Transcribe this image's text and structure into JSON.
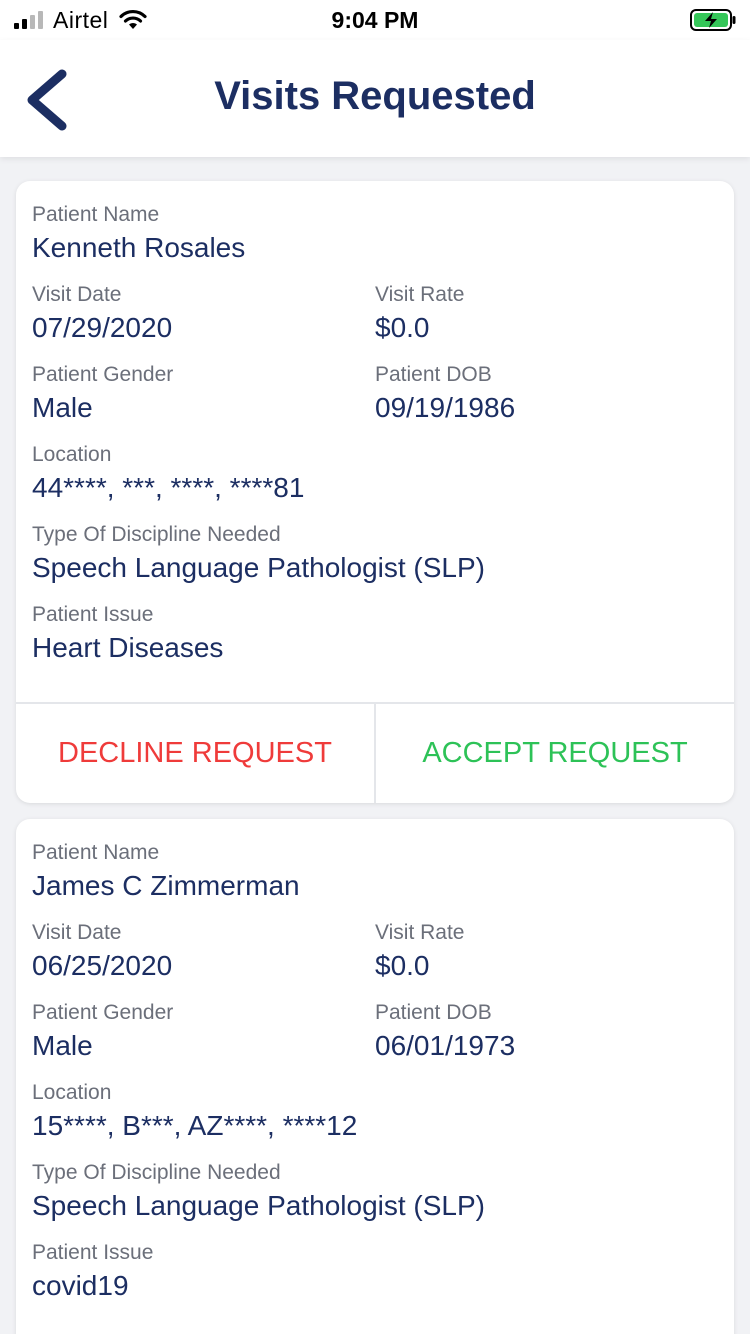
{
  "status_bar": {
    "carrier": "Airtel",
    "time": "9:04 PM"
  },
  "header": {
    "title": "Visits Requested"
  },
  "colors": {
    "primary": "#1c2e62",
    "decline": "#ef3b3a",
    "accept": "#2dc257",
    "label": "#6b6f7a"
  },
  "visits": [
    {
      "patient_name_label": "Patient Name",
      "patient_name": "Kenneth Rosales",
      "visit_date_label": "Visit Date",
      "visit_date": "07/29/2020",
      "visit_rate_label": "Visit Rate",
      "visit_rate": "$0.0",
      "gender_label": "Patient Gender",
      "gender": "Male",
      "dob_label": "Patient DOB",
      "dob": "09/19/1986",
      "location_label": "Location",
      "location": "44****, ***, ****, ****81",
      "discipline_label": "Type Of Discipline Needed",
      "discipline": "Speech Language Pathologist (SLP)",
      "issue_label": "Patient Issue",
      "issue": "Heart Diseases",
      "decline_label": "DECLINE REQUEST",
      "accept_label": "ACCEPT REQUEST"
    },
    {
      "patient_name_label": "Patient Name",
      "patient_name": "James C Zimmerman",
      "visit_date_label": "Visit Date",
      "visit_date": "06/25/2020",
      "visit_rate_label": "Visit Rate",
      "visit_rate": "$0.0",
      "gender_label": "Patient Gender",
      "gender": "Male",
      "dob_label": "Patient DOB",
      "dob": "06/01/1973",
      "location_label": "Location",
      "location": "15****, B***, AZ****, ****12",
      "discipline_label": "Type Of Discipline Needed",
      "discipline": "Speech Language Pathologist (SLP)",
      "issue_label": "Patient Issue",
      "issue": "covid19"
    }
  ]
}
